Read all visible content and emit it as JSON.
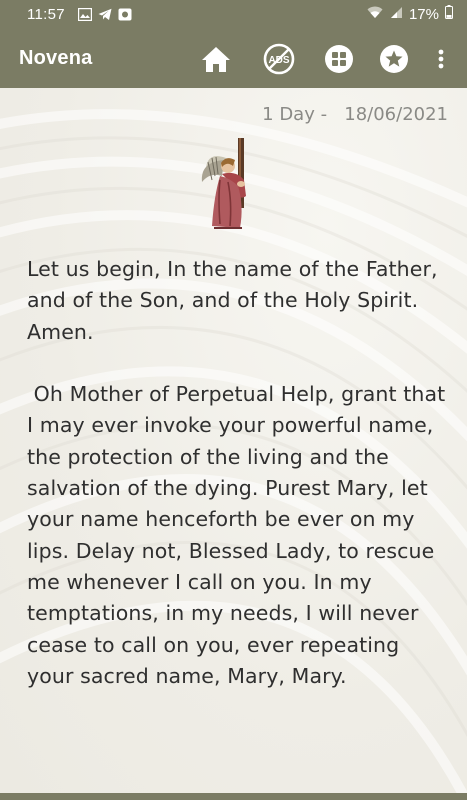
{
  "status_bar": {
    "time": "11:57",
    "battery_text": "17%",
    "left_icons": [
      "gallery-icon",
      "telegram-icon",
      "notification-box-icon"
    ],
    "right_icons": [
      "wifi-icon",
      "signal-icon",
      "battery-icon"
    ]
  },
  "app_bar": {
    "title": "Novena",
    "actions": [
      "home-icon",
      "no-ads-icon",
      "grid-icon",
      "star-icon",
      "overflow-menu-icon"
    ],
    "no_ads_label": "ADS"
  },
  "content": {
    "day_label": "1 Day -",
    "date": "18/06/2021",
    "prayer_text": "Let us begin, In the name of the Father, and of the Son, and of the Holy Spirit. Amen.\n\n Oh Mother of Perpetual Help, grant that I may ever invoke your powerful name, the protection of the living and the salvation of the dying. Purest Mary, let your name henceforth be ever on my lips. Delay not, Blessed Lady, to rescue me whenever I call on you. In my temptations, in my needs, I will never cease to call on you, ever repeating your sacred name, Mary, Mary."
  },
  "colors": {
    "bar": "#7b7c64",
    "background": "#f1efe8",
    "text": "#2f2f2f",
    "date_text": "#8a8a86"
  }
}
